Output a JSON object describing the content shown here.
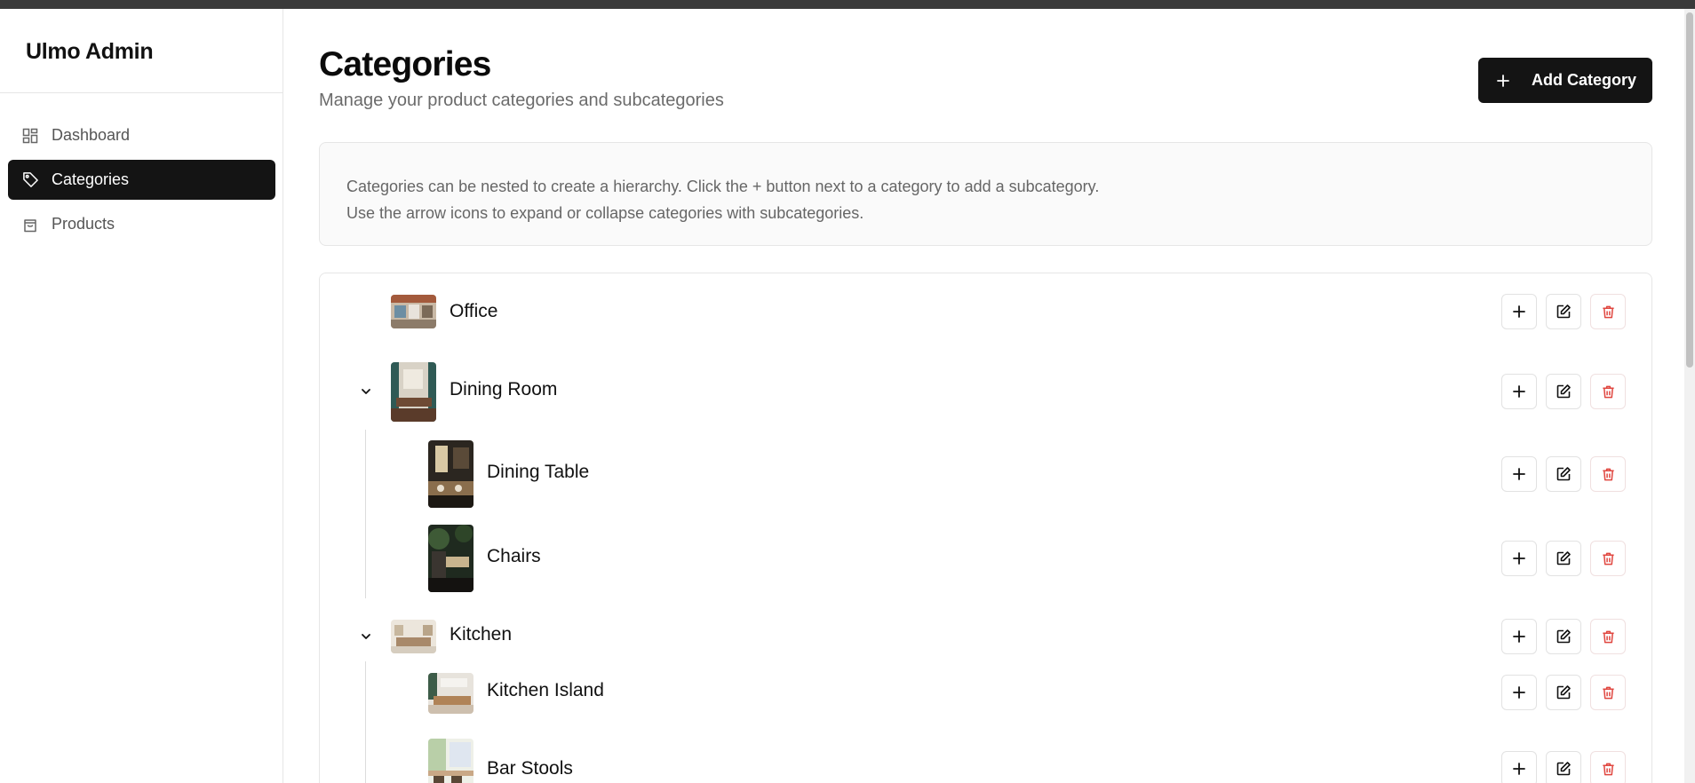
{
  "brand": "Ulmo Admin",
  "sidebar": {
    "items": [
      {
        "label": "Dashboard",
        "icon": "dashboard-icon",
        "active": false
      },
      {
        "label": "Categories",
        "icon": "tag-icon",
        "active": true
      },
      {
        "label": "Products",
        "icon": "shopping-bag-icon",
        "active": false
      }
    ]
  },
  "header": {
    "title": "Categories",
    "subtitle": "Manage your product categories and subcategories",
    "add_button_label": "Add Category"
  },
  "info": {
    "line1": "Categories can be nested to create a hierarchy. Click the + button next to a category to add a subcategory.",
    "line2": "Use the arrow icons to expand or collapse categories with subcategories."
  },
  "categories": [
    {
      "name": "Office",
      "level": 0,
      "expanded": null
    },
    {
      "name": "Dining Room",
      "level": 0,
      "expanded": true
    },
    {
      "name": "Dining Table",
      "level": 1,
      "expanded": null
    },
    {
      "name": "Chairs",
      "level": 1,
      "expanded": null
    },
    {
      "name": "Kitchen",
      "level": 0,
      "expanded": true
    },
    {
      "name": "Kitchen Island",
      "level": 1,
      "expanded": null
    },
    {
      "name": "Bar Stools",
      "level": 1,
      "expanded": null
    }
  ],
  "colors": {
    "primary": "#141414",
    "delete": "#e0463f",
    "muted_text": "#6b6b6b",
    "border": "#e6e6e6"
  }
}
